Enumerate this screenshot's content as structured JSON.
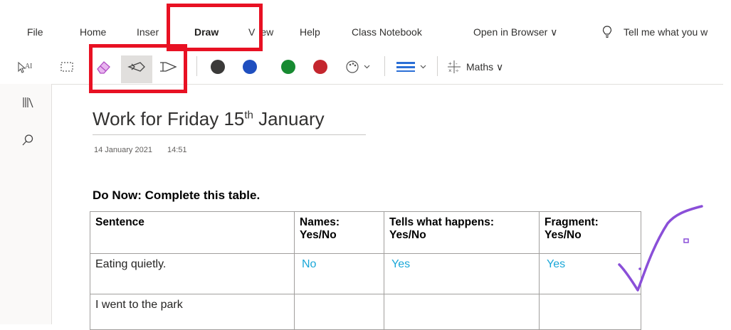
{
  "menu": {
    "file": "File",
    "home": "Home",
    "insert": "Inser",
    "draw": "Draw",
    "view": "V",
    "view_rest": "ew",
    "help": "Help",
    "class_notebook": "Class Notebook",
    "open_in_browser": "Open in Browser ∨",
    "tell_me": "Tell me what you w"
  },
  "toolbar": {
    "maths_label": "Maths ∨",
    "pen_colors": [
      "#3b3a39",
      "#1f4fbf",
      "#178a31",
      "#c4262e"
    ]
  },
  "page": {
    "title_main": "Work for Friday 15",
    "title_sup": "th",
    "title_end": " January",
    "date": "14 January 2021",
    "time": "14:51",
    "heading": "Do Now: Complete this table."
  },
  "table": {
    "headers": {
      "c1": "Sentence",
      "c2a": "Names:",
      "c2b": "Yes/No",
      "c3a": "Tells what happens:",
      "c3b": "Yes/No",
      "c4a": "Fragment:",
      "c4b": "Yes/No"
    },
    "rows": [
      {
        "sentence": "Eating quietly.",
        "names": "No",
        "tells": "Yes",
        "fragment": "Yes"
      },
      {
        "sentence": "I went to the park",
        "names": "",
        "tells": "",
        "fragment": ""
      }
    ]
  }
}
